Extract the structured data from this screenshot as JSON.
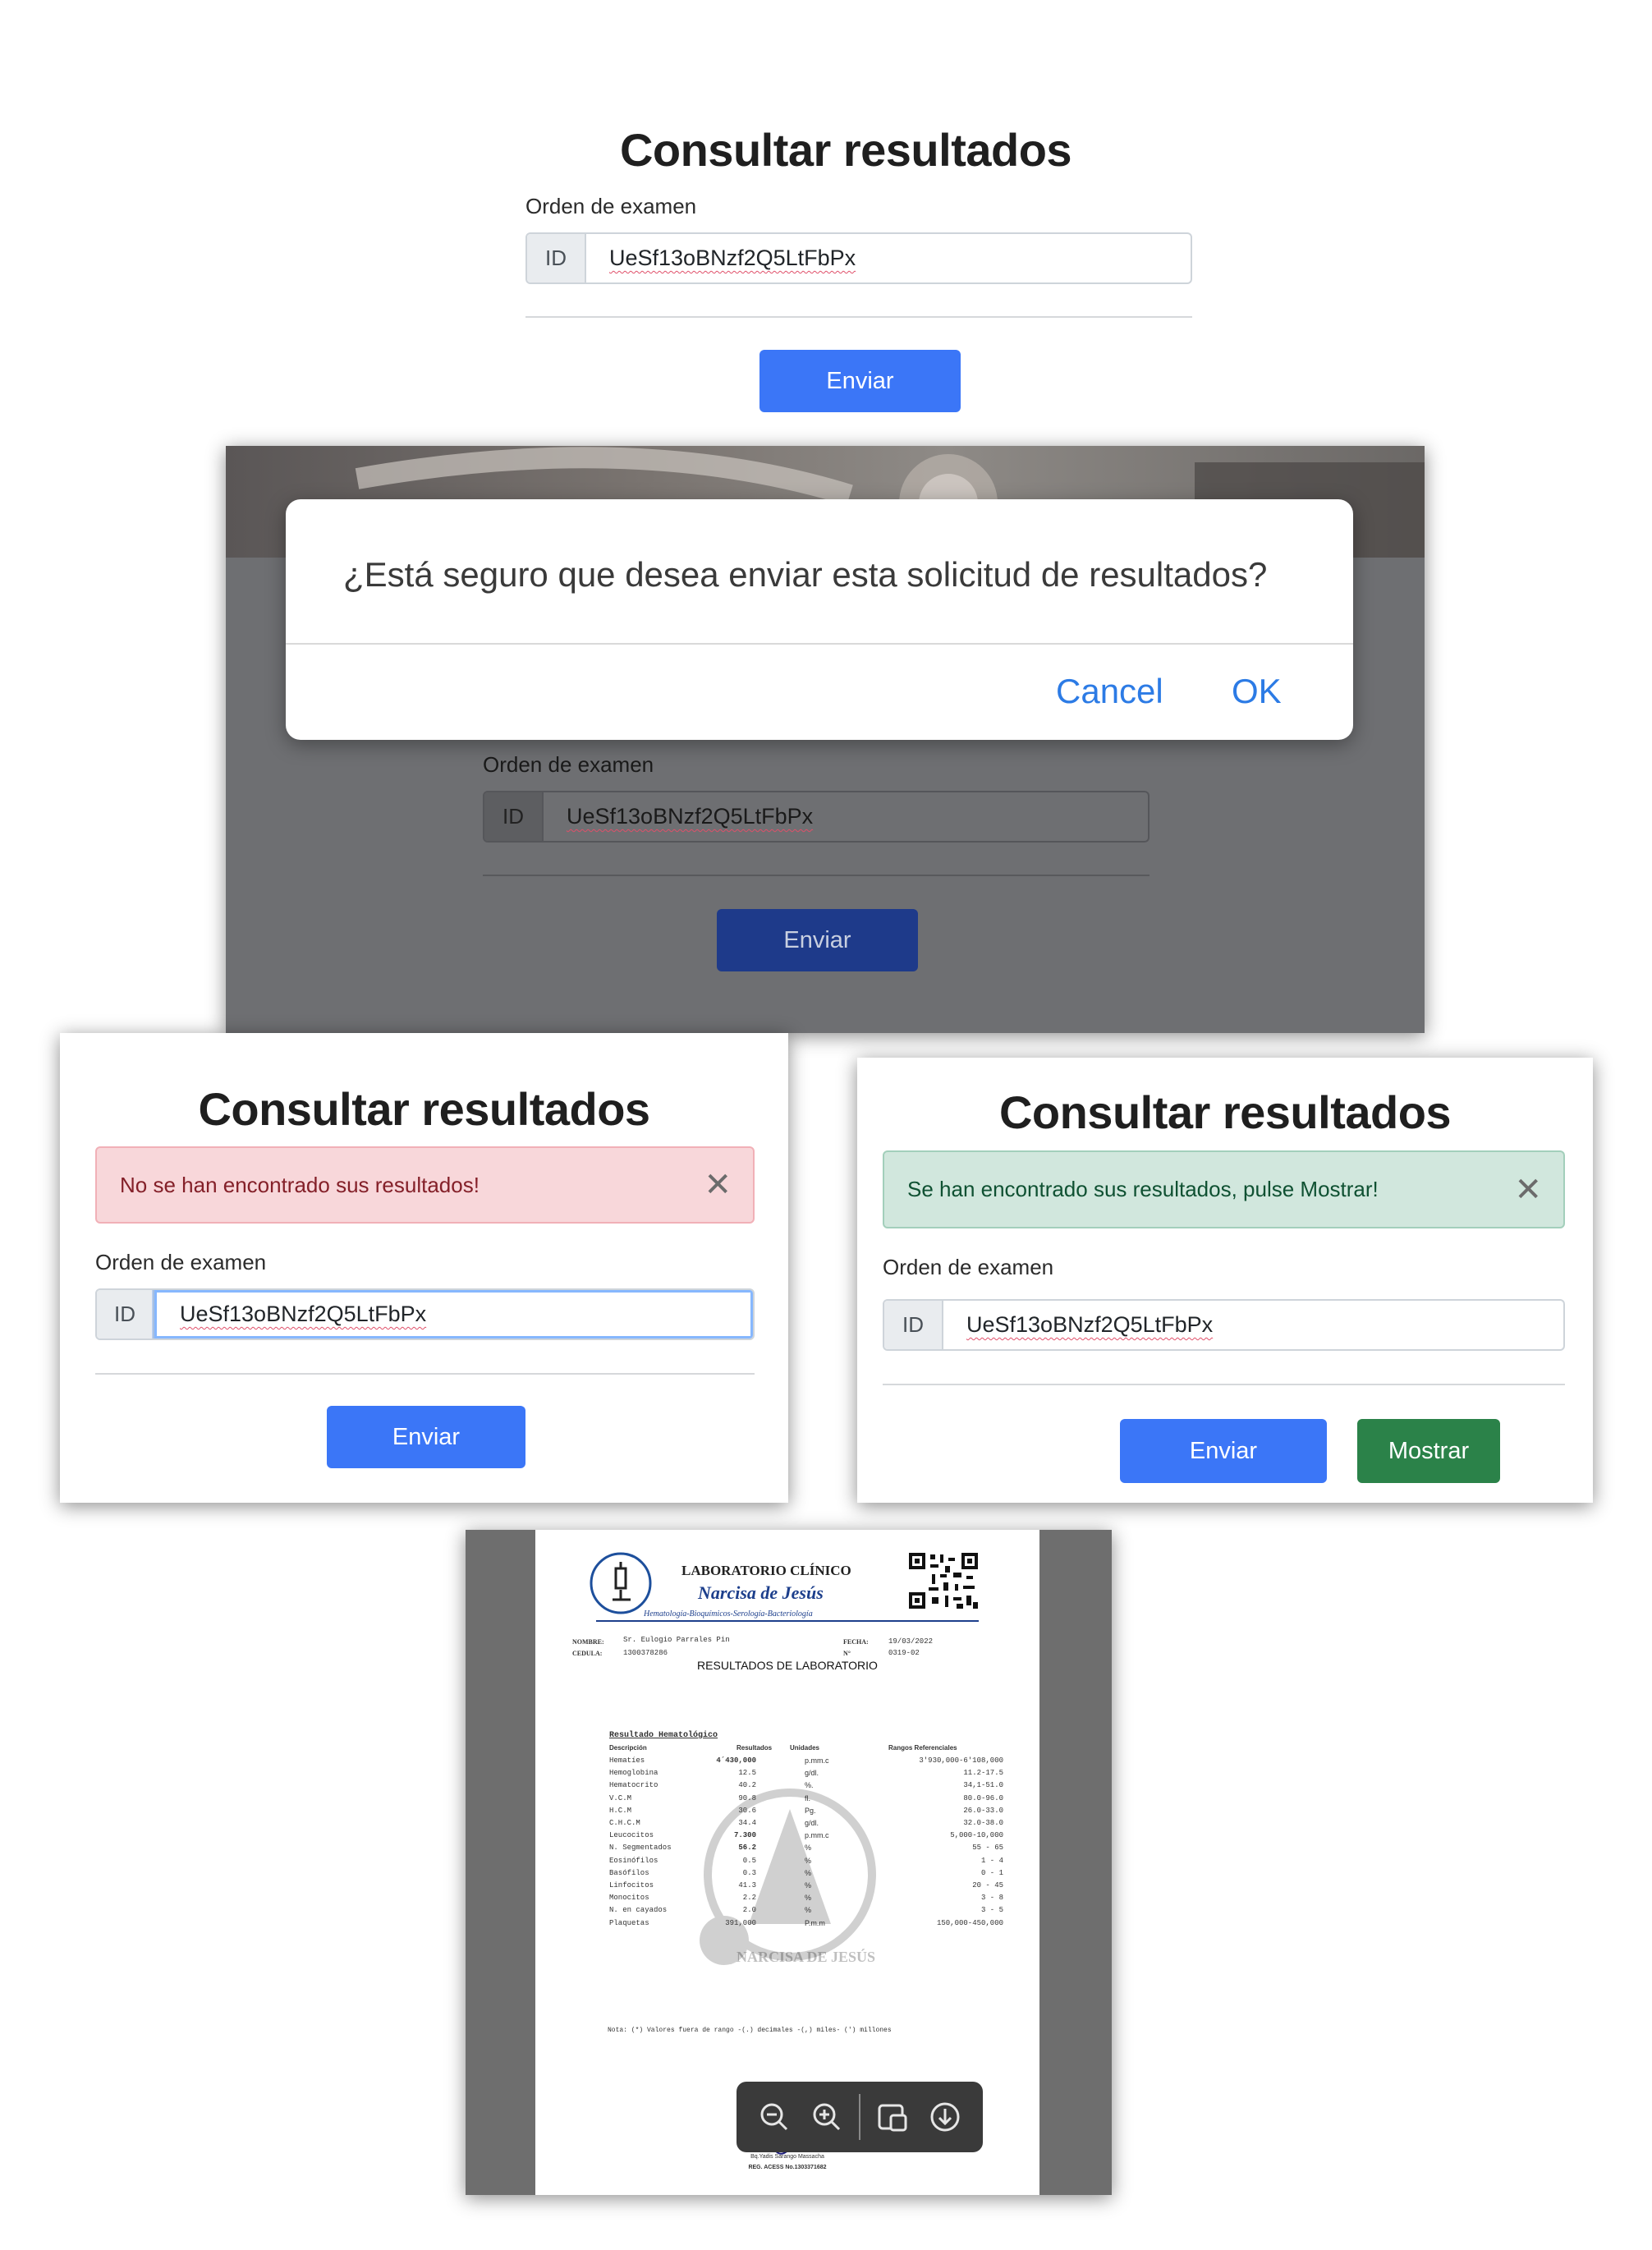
{
  "panel1": {
    "title": "Consultar resultados",
    "field_label": "Orden de examen",
    "addon": "ID",
    "value": "UeSf13oBNzf2Q5LtFbPx",
    "submit": "Enviar"
  },
  "panel2": {
    "dialog_message": "¿Está seguro que desea enviar esta solicitud de resultados?",
    "cancel": "Cancel",
    "ok": "OK",
    "field_label": "Orden de examen",
    "addon": "ID",
    "value": "UeSf13oBNzf2Q5LtFbPx",
    "submit": "Enviar"
  },
  "panel3": {
    "title": "Consultar resultados",
    "alert": "No se han encontrado sus resultados!",
    "close": "✕",
    "field_label": "Orden de examen",
    "addon": "ID",
    "value": "UeSf13oBNzf2Q5LtFbPx",
    "submit": "Enviar"
  },
  "panel4": {
    "title": "Consultar resultados",
    "alert": "Se han encontrado sus resultados, pulse Mostrar!",
    "close": "✕",
    "field_label": "Orden de examen",
    "addon": "ID",
    "value": "UeSf13oBNzf2Q5LtFbPx",
    "submit": "Enviar",
    "show": "Mostrar"
  },
  "report": {
    "lab_name": "LABORATORIO CLÍNICO",
    "lab_subname": "Narcisa de Jesús",
    "lab_services": "Hematología-Bioquímicos-Serología-Bacteriología",
    "name_label": "NOMBRE:",
    "name_value": "Sr. Eulogio Parrales Pin",
    "id_label": "CEDULA:",
    "id_value": "1300378286",
    "date_label": "FECHA:",
    "date_value": "19/03/2022",
    "num_label": "N°",
    "num_value": "0319-02",
    "heading": "RESULTADOS DE LABORATORIO",
    "section": "Resultado Hematológico",
    "columns": [
      "Descripción",
      "Resultados",
      "Unidades",
      "Rangos Referenciales"
    ],
    "rows": [
      [
        "Hematíes",
        "4´430,000",
        "p.mm.c",
        "3'930,000-6'108,000"
      ],
      [
        "Hemoglobina",
        "12.5",
        "g/dl.",
        "11.2-17.5"
      ],
      [
        "Hematocrito",
        "40.2",
        "%.",
        "34,1-51.0"
      ],
      [
        "V.C.M",
        "90.8",
        "fl.",
        "80.0-96.0"
      ],
      [
        "H.C.M",
        "30.6",
        "Pg.",
        "26.0-33.0"
      ],
      [
        "C.H.C.M",
        "34.4",
        "g/dl.",
        "32.0-38.0"
      ],
      [
        "Leucocitos",
        "7.300",
        "p.mm.c",
        "5,000-10,000"
      ],
      [
        "N. Segmentados",
        "56.2",
        "%",
        "55 - 65"
      ],
      [
        "Eosinófilos",
        "0.5",
        "%",
        "1 - 4"
      ],
      [
        "Basófilos",
        "0.3",
        "%",
        "0 - 1"
      ],
      [
        "Linfocitos",
        "41.3",
        "%",
        "20 - 45"
      ],
      [
        "Monocitos",
        "2.2",
        "%",
        "3 - 8"
      ],
      [
        "N. en cayados",
        "2.0",
        "%",
        "3 - 5"
      ],
      [
        "Plaquetas",
        "391,000",
        "P.m.m",
        "150,000-450,000"
      ]
    ],
    "watermark": "NARCISA DE JESÚS",
    "note": "Nota: (*) Valores fuera de rango -(.) decimales -(,) miles- (') millones",
    "signer": "Bq.Yadis Sarango Massacha",
    "reg": "REG. ACESS No.1303371682",
    "toolbar": [
      "zoom-out-icon",
      "zoom-in-icon",
      "fit-page-icon",
      "download-icon"
    ]
  }
}
